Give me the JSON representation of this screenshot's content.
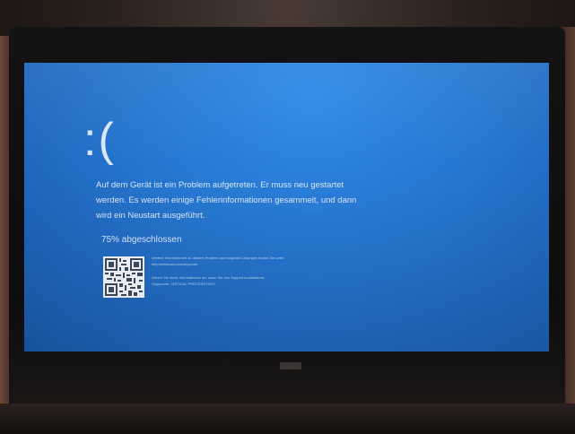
{
  "bsod": {
    "sad_face": ":(",
    "message": "Auf dem Gerät ist ein Problem aufgetreten. Er muss neu gestartet\nwerden. Es werden einige Fehlerinformationen gesammelt, und dann\nwird ein Neustart ausgeführt.",
    "progress_text": "75% abgeschlossen",
    "progress_percent": 75,
    "info_lines": [
      "Weitere Informationen zu diesem Problem und mögliche Lösungen finden Sie unter",
      "http://windows.com/stopcode",
      "",
      "Geben Sie diese Informationen an, wenn Sie den Support kontaktieren:",
      "Stoppcode: CRITICAL PROCESS DIED"
    ]
  },
  "colors": {
    "screen_blue": "#2778d2",
    "text": "#e8f1ff"
  },
  "icons": {
    "qr": "qr-code-icon"
  }
}
